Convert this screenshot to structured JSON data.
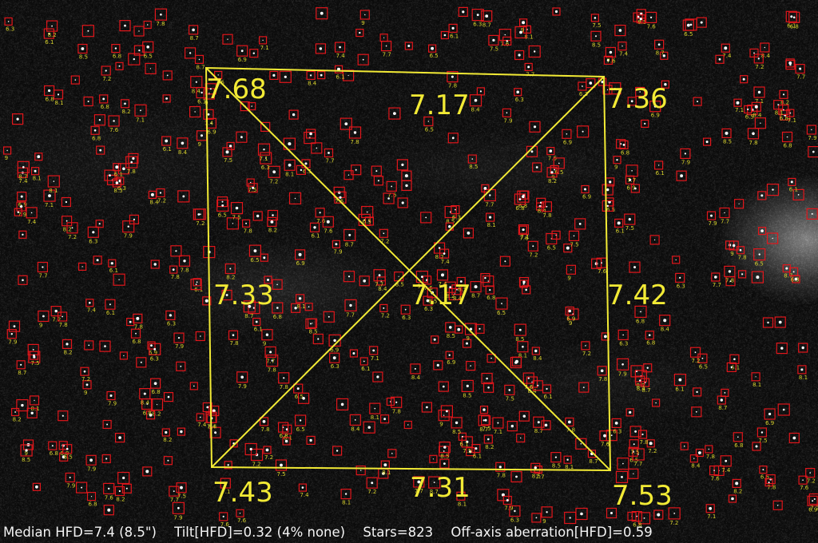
{
  "colors": {
    "overlay": "#f2ea35",
    "star_box": "#e0161b",
    "status_text": "#f4f4f4"
  },
  "tilt_analysis": {
    "corners": {
      "top_left": "7.68",
      "top_right": "7.36",
      "bottom_left": "7.43",
      "bottom_right": "7.53"
    },
    "edges": {
      "top": "7.17",
      "left": "7.33",
      "right": "7.42",
      "bottom": "7.31"
    },
    "center": "7.17"
  },
  "status_bar": {
    "median_hfd": "Median HFD=7.4 (8.5\")",
    "tilt": "Tilt[HFD]=0.32 (4% none)",
    "stars": "Stars=823",
    "off_axis": "Off-axis aberration[HFD]=0.59"
  }
}
